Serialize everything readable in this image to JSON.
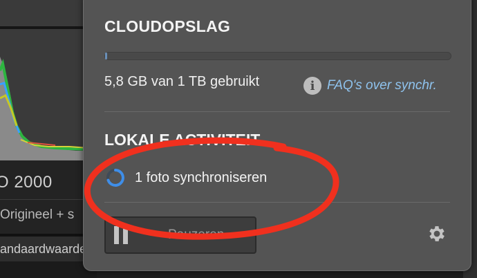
{
  "background": {
    "iso_text": "O 2000",
    "original_text": "Origineel + s",
    "standard_text": "andaardwaarde"
  },
  "panel": {
    "title": "CLOUDOPSLAG",
    "storage": {
      "usage_text": "5,8 GB van 1 TB gebruikt",
      "used_fraction": 0.0058
    },
    "faq": {
      "icon": "info-icon",
      "label": "FAQ's over synchr."
    },
    "local_activity": {
      "title": "LOKALE ACTIVITEIT",
      "sync_text": "1 foto synchroniseren",
      "spinner_icon": "spinner-icon"
    },
    "pause_button": {
      "label": "Pauzeren",
      "icon": "pause-icon"
    },
    "settings_icon": "gear-icon"
  },
  "colors": {
    "panel_bg": "#545454",
    "link": "#8fc3ee",
    "spinner": "#3f8ee8",
    "annotation": "#f0301e"
  }
}
